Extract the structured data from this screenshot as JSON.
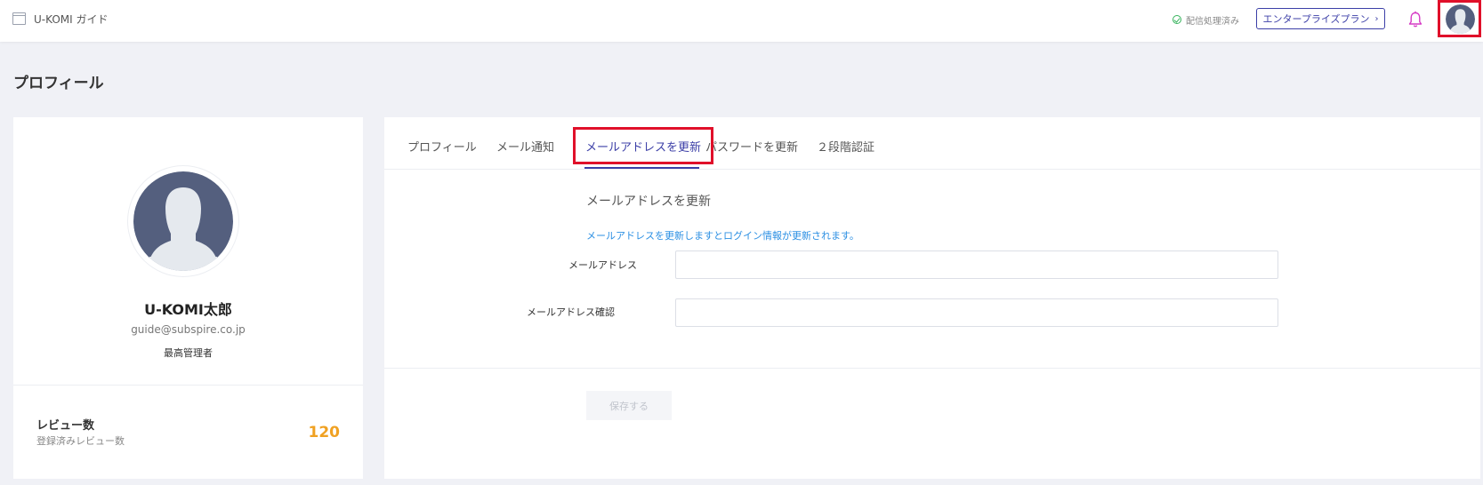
{
  "header": {
    "app_name": "U-KOMI ガイド",
    "app_icon": "window-icon",
    "status_text": "配信処理済み",
    "status_icon": "check-circle-icon",
    "plan_button": "エンタープライズプラン",
    "plan_chevron": "›",
    "bell_icon": "bell-icon",
    "avatar_icon": "avatar-icon"
  },
  "page": {
    "title": "プロフィール"
  },
  "profile": {
    "name": "U-KOMI太郎",
    "email": "guide@subspire.co.jp",
    "role": "最高管理者",
    "stat_title": "レビュー数",
    "stat_sub": "登録済みレビュー数",
    "stat_value": "120"
  },
  "tabs": [
    {
      "label": "プロフィール",
      "active": false
    },
    {
      "label": "メール通知",
      "active": false
    },
    {
      "label": "メールアドレスを更新",
      "active": true
    },
    {
      "label": "パスワードを更新",
      "active": false
    },
    {
      "label": "２段階認証",
      "active": false
    }
  ],
  "form": {
    "title": "メールアドレスを更新",
    "note": "メールアドレスを更新しますとログイン情報が更新されます。",
    "email_label": "メールアドレス",
    "email_value": "",
    "confirm_label": "メールアドレス確認",
    "confirm_value": "",
    "save_label": "保存する"
  },
  "colors": {
    "accent": "#3c3fa7",
    "highlight": "#e0102a",
    "info": "#2b8fe3",
    "stat": "#f0a122",
    "notification": "#d63bc5"
  }
}
